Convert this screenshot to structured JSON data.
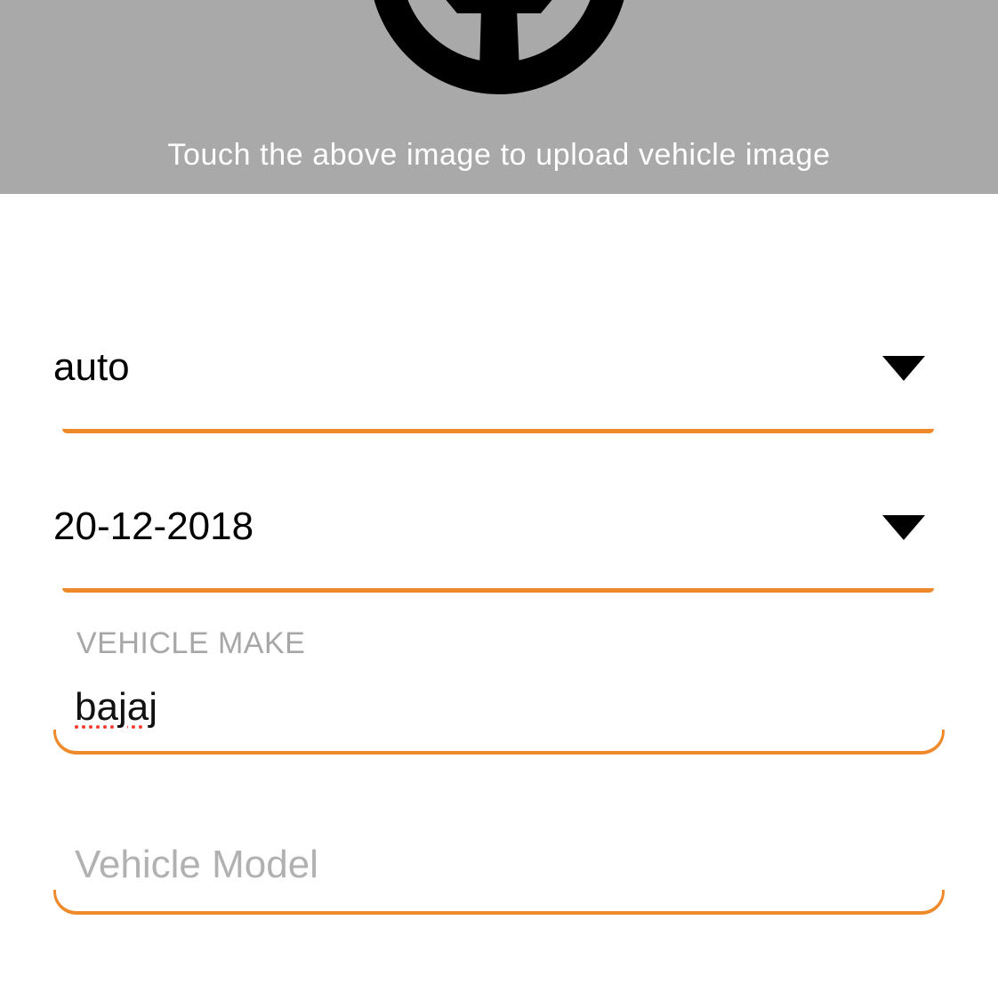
{
  "upload": {
    "hint": "Touch the above image to upload vehicle image",
    "icon": "steering-wheel-icon",
    "background": "#a9a9a9"
  },
  "vehicle_type": {
    "value": "auto",
    "icon": "triangle-down-icon"
  },
  "registration_date": {
    "value": "20-12-2018",
    "icon": "triangle-down-icon"
  },
  "vehicle_make": {
    "label": "VEHICLE MAKE",
    "value": "bajaj"
  },
  "vehicle_model": {
    "placeholder": "Vehicle Model",
    "value": ""
  },
  "colors": {
    "accent": "#ef8a2c",
    "label": "#a7a7a7",
    "text": "#000000"
  }
}
